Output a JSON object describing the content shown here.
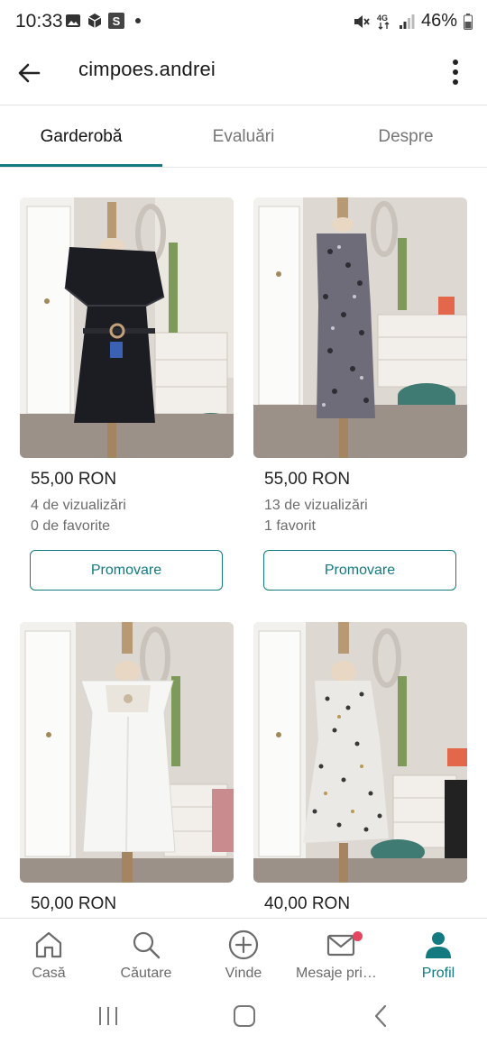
{
  "status_bar": {
    "time": "10:33",
    "battery": "46%",
    "network": "4G"
  },
  "header": {
    "title": "cimpoes.andrei"
  },
  "tabs": [
    {
      "label": "Garderobă",
      "active": true
    },
    {
      "label": "Evaluări",
      "active": false
    },
    {
      "label": "Despre",
      "active": false
    }
  ],
  "items": [
    {
      "price": "55,00 RON",
      "views": "4 de vizualizări",
      "favorites": "0 de favorite",
      "promo_label": "Promovare",
      "dress_color": "#1c1d22",
      "dress": "black-off-shoulder-dress"
    },
    {
      "price": "55,00 RON",
      "views": "13 de vizualizări",
      "favorites": "1 favorit",
      "promo_label": "Promovare",
      "dress_color": "#6e6c78",
      "dress": "leopard-slip-dress"
    },
    {
      "price": "50,00 RON",
      "dress_color": "#f6f6f4",
      "dress": "white-square-neck-dress"
    },
    {
      "price": "40,00 RON",
      "dress_color": "#ebe9e6",
      "dress": "floral-wrap-dress"
    }
  ],
  "bottom_nav": [
    {
      "label": "Casă",
      "icon": "home-icon"
    },
    {
      "label": "Căutare",
      "icon": "search-icon"
    },
    {
      "label": "Vinde",
      "icon": "plus-circle-icon"
    },
    {
      "label": "Mesaje prim...",
      "icon": "mail-icon"
    },
    {
      "label": "Profil",
      "icon": "profile-icon",
      "active": true
    }
  ],
  "colors": {
    "accent": "#137a7f",
    "notification": "#e4455f"
  }
}
